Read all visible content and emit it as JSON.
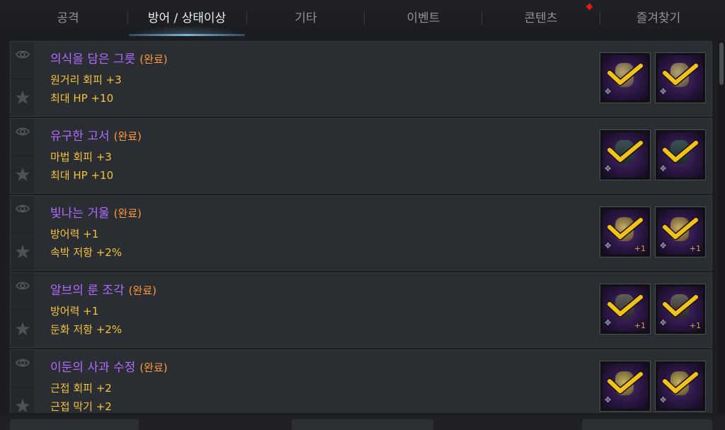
{
  "tabs": [
    {
      "label": "공격",
      "active": false
    },
    {
      "label": "방어 / 상태이상",
      "active": true
    },
    {
      "label": "기타",
      "active": false
    },
    {
      "label": "이벤트",
      "active": false
    },
    {
      "label": "콘텐츠",
      "active": false,
      "has_new": true
    },
    {
      "label": "즐겨찾기",
      "active": false
    }
  ],
  "items": [
    {
      "title": "의식을 담은 그릇",
      "status": "(완료)",
      "stats": [
        "원거리 회피 +3",
        "최대 HP +10"
      ],
      "slots": [
        {
          "icon": "vessel-icon",
          "completed": true,
          "quantity": ""
        },
        {
          "icon": "vessel-icon",
          "completed": true,
          "quantity": ""
        }
      ]
    },
    {
      "title": "유구한 고서",
      "status": "(완료)",
      "stats": [
        "마법 회피 +3",
        "최대 HP +10"
      ],
      "slots": [
        {
          "icon": "book-icon",
          "completed": true,
          "quantity": ""
        },
        {
          "icon": "book-icon",
          "completed": true,
          "quantity": ""
        }
      ]
    },
    {
      "title": "빛나는 거울",
      "status": "(완료)",
      "stats": [
        "방어력 +1",
        "속박 저항 +2%"
      ],
      "slots": [
        {
          "icon": "mirror-icon",
          "completed": true,
          "quantity": "+1"
        },
        {
          "icon": "mirror-icon",
          "completed": true,
          "quantity": "+1"
        }
      ]
    },
    {
      "title": "알브의 룬 조각",
      "status": "(완료)",
      "stats": [
        "방어력 +1",
        "둔화 저항 +2%"
      ],
      "slots": [
        {
          "icon": "rune-shard-icon",
          "completed": true,
          "quantity": "+1"
        },
        {
          "icon": "rune-shard-icon",
          "completed": true,
          "quantity": "+1"
        }
      ]
    },
    {
      "title": "이둔의 사과 수정",
      "status": "(완료)",
      "stats": [
        "근접 회피 +2",
        "근접 막기 +2"
      ],
      "slots": [
        {
          "icon": "apple-crystal-icon",
          "completed": true,
          "quantity": ""
        },
        {
          "icon": "apple-crystal-icon",
          "completed": true,
          "quantity": ""
        }
      ]
    }
  ],
  "colors": {
    "title": "#b06bff",
    "status": "#ff9a3c",
    "stat": "#f5c33b",
    "check": "#f2c21c",
    "new_badge": "#e01a1a"
  }
}
